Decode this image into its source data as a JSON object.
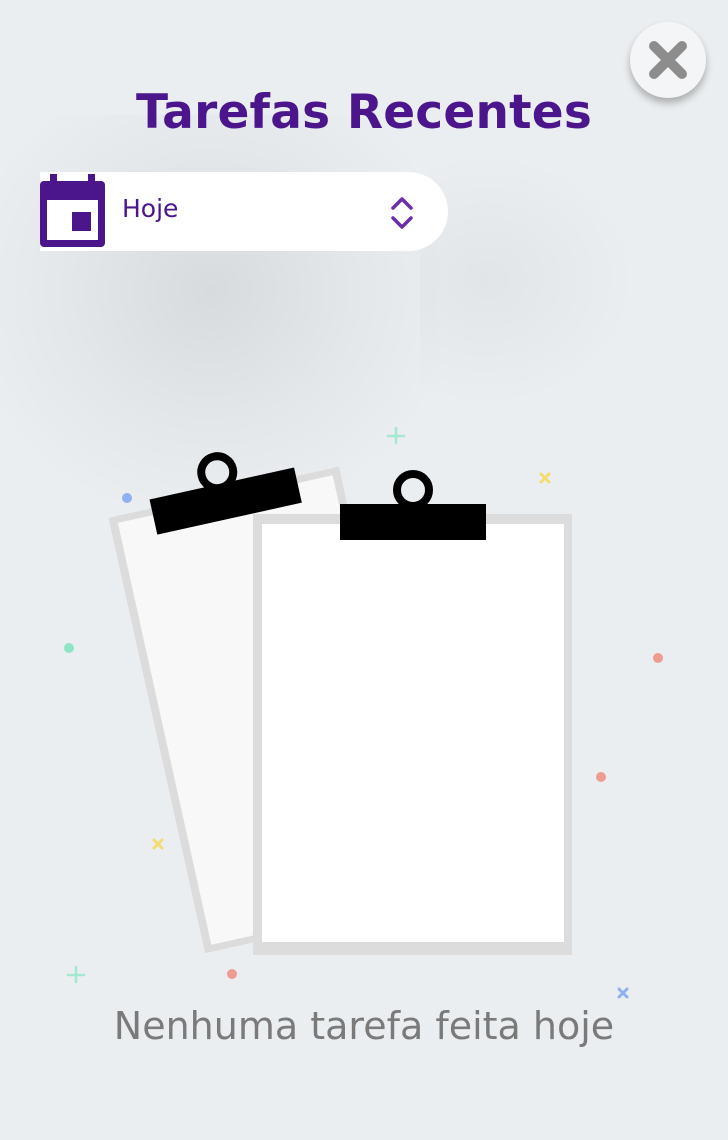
{
  "header": {
    "title": "Tarefas Recentes",
    "close_icon": "close-x-icon"
  },
  "period_select": {
    "selected": "Hoje",
    "leading_icon": "calendar-icon",
    "trailing_icon": "sort-up-down-icon"
  },
  "empty_state": {
    "illustration": "empty-clipboards",
    "message": "Nenhuma tarefa feita hoje"
  },
  "colors": {
    "primary": "#4b168c",
    "background": "#ebeef0",
    "message_text": "#7a7a7a"
  }
}
